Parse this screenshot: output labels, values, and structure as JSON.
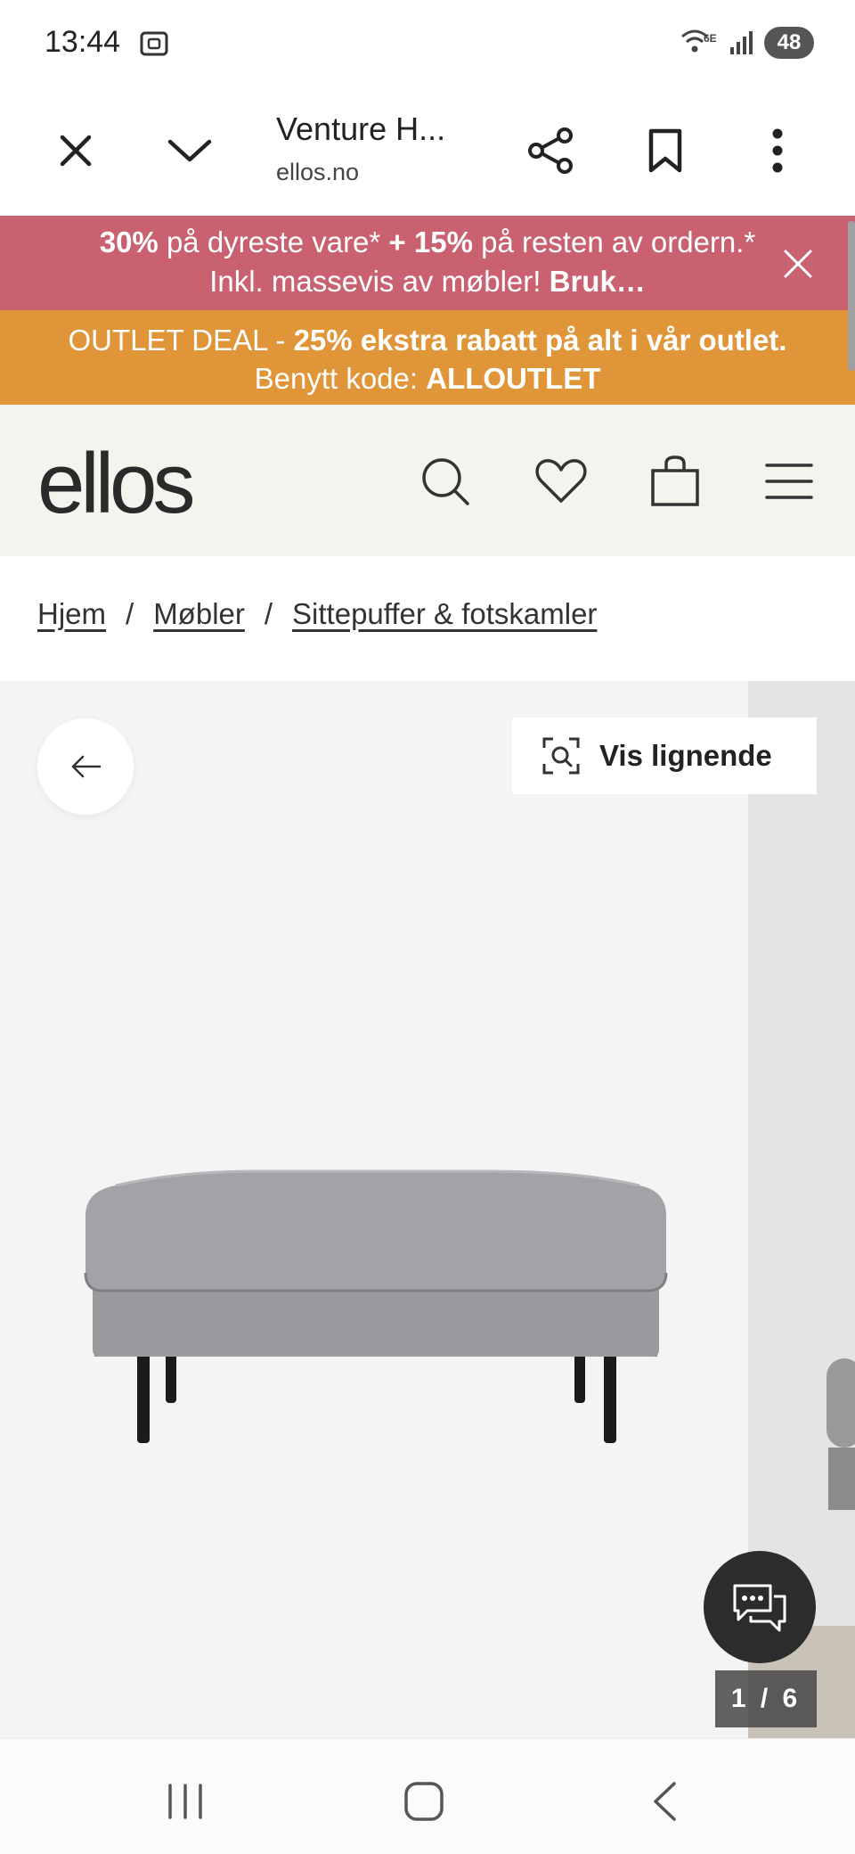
{
  "status_bar": {
    "time": "13:44",
    "network": "6E",
    "battery": "48"
  },
  "browser": {
    "title": "Venture H...",
    "url": "ellos.no",
    "icons": [
      "close-icon",
      "chevron-down-icon",
      "share-icon",
      "bookmark-icon",
      "more-vert-icon"
    ]
  },
  "promo": {
    "red": {
      "part1_bold": "30%",
      "part2": " på dyreste vare* ",
      "part3_bold": "+ 15%",
      "part4": " på resten av ordern.* Inkl. massevis av møbler! ",
      "part5_bold": "Bruk…"
    },
    "orange": {
      "part1": "OUTLET DEAL - ",
      "part2_bold": "25% ekstra rabatt på alt i vår outlet.",
      "part3": " Benytt kode: ",
      "part4_bold": "ALLOUTLET"
    },
    "colors": {
      "red": "#c96170",
      "orange": "#e09538"
    }
  },
  "header": {
    "logo": "ellos",
    "icons": [
      "search-icon",
      "heart-icon",
      "bag-icon",
      "menu-icon"
    ]
  },
  "breadcrumb": {
    "items": [
      "Hjem",
      "Møbler",
      "Sittepuffer & fotskamler"
    ],
    "separator": "/"
  },
  "gallery": {
    "similar_label": "Vis lignende",
    "counter": "1 / 6"
  }
}
